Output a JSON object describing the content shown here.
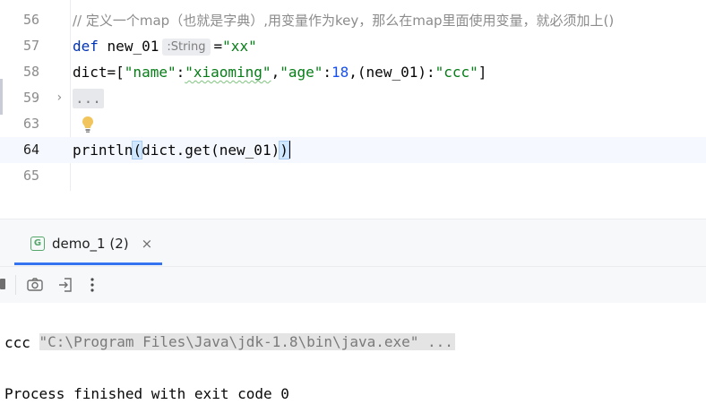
{
  "editor": {
    "lines": [
      {
        "num": "56",
        "text": "// 定义一个map（也就是字典）,用变量作为key，那么在map里面使用变量，就必须加上()"
      },
      {
        "num": "57",
        "kw": "def",
        "name": "new_01",
        "type_hint": ":String",
        "assign": "=",
        "value": "\"xx\""
      },
      {
        "num": "58",
        "prefix": "dict=[",
        "k1": "\"name\"",
        "c1": ":",
        "v1": "\"xiaoming\"",
        "sep1": ",",
        "k2": "\"age\"",
        "c2": ":",
        "v2": "18",
        "sep2": ",(new_01):",
        "v3": "\"ccc\"",
        "suffix": "]"
      },
      {
        "num": "59",
        "folded": "..."
      },
      {
        "num": "63"
      },
      {
        "num": "64",
        "open": "println",
        "paren_open": "(",
        "inner": "dict.get(new_01)",
        "paren_close": ")"
      },
      {
        "num": "65"
      }
    ]
  },
  "run_panel": {
    "tab_label": "demo_1 (2)",
    "tab_icon_letter": "G",
    "close_glyph": "×",
    "console": {
      "command": "\"C:\\Program Files\\Java\\jdk-1.8\\bin\\java.exe\" ...",
      "output": "ccc",
      "exit": "Process finished with exit code 0"
    }
  },
  "colors": {
    "accent": "#3574f0",
    "keyword": "#0033b3",
    "string": "#067d17",
    "number": "#1750eb"
  }
}
